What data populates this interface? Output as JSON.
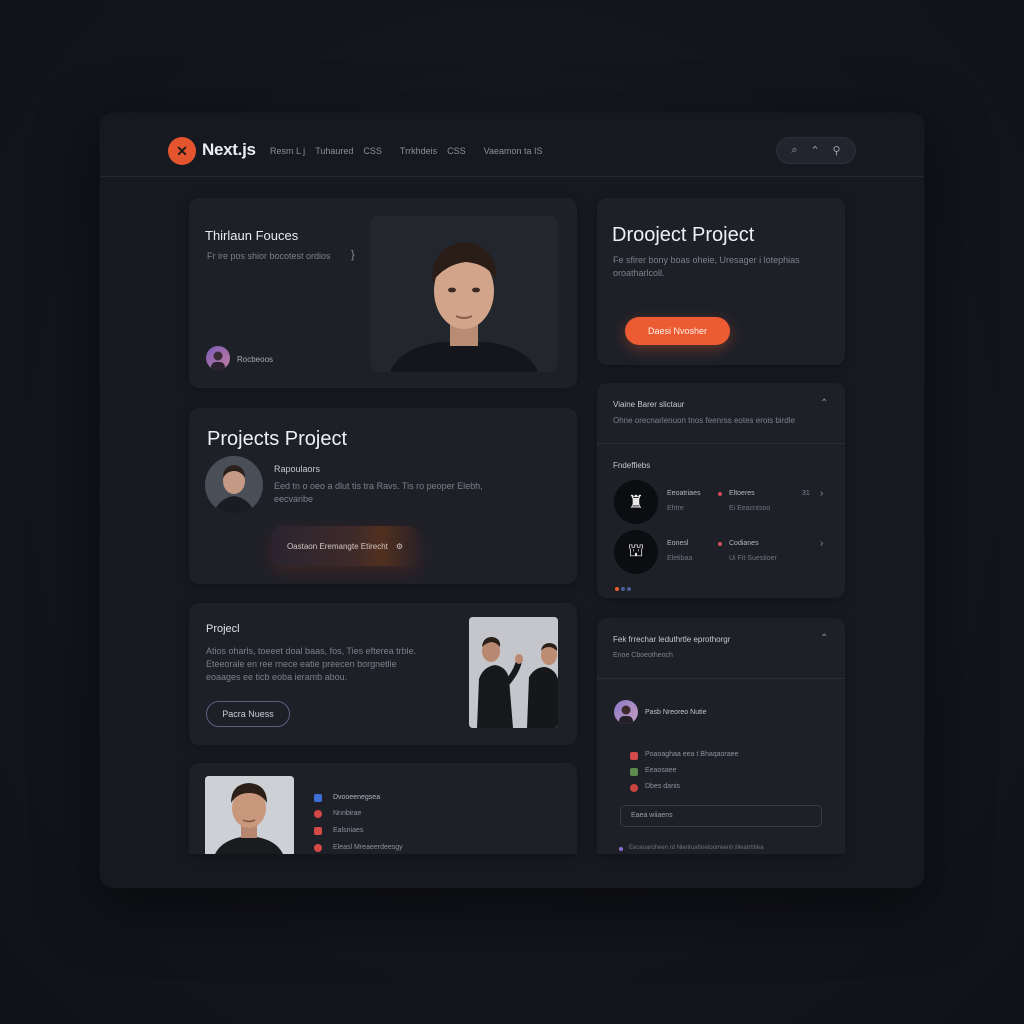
{
  "app": {
    "logo_symbol": "✕",
    "logo_text": "Next.js",
    "nav": [
      "Resm L j",
      "Tuhaured",
      "CSS",
      "Trrkhdeis",
      "CSS",
      "Vaeamon ta IS"
    ],
    "search_icons": [
      "search-icon",
      "bell-icon",
      "user-icon"
    ],
    "search_glyphs": [
      "⌕",
      "⌃",
      "⚲"
    ]
  },
  "colors": {
    "accent": "#ec5b32",
    "bg": "#171920",
    "card": "#1e2028"
  },
  "hero": {
    "title": "Thirlaun Fouces",
    "text": "Fr ire pos shior bocotest ordios",
    "arrow": "}",
    "author": "Rocbeoos"
  },
  "project_card": {
    "title": "Drooject Project",
    "text": "Fe sfirer bony boas oheie, Uresager i lotephias oroatharlcoll.",
    "button": "Daesi Nvosher"
  },
  "projects_card": {
    "title": "Projects Project",
    "name": "Rapoulaors",
    "text": "Eed tn o oeo a dlut tis tra Ravs. Tis ro peoper Elebh, eecvaribe",
    "button": "Oastaon Eremangte Etirecht",
    "button_icon": "⚙"
  },
  "settings_card": {
    "title": "Viaine Barer slictaur",
    "subtitle": "Ohne orecnarlenuon tnos feenrss eotes erois birdle",
    "section": "Fndeffiebs",
    "items": [
      {
        "icon": "cup-icon",
        "glyph": "♜",
        "a": "Eeoatriaes",
        "b": "Eltoeres",
        "num": "31",
        "c": "Ehtre",
        "d": "Ei Eeacntsoo"
      },
      {
        "icon": "basket-icon",
        "glyph": "⛫",
        "a": "Eonesl",
        "b": "Codianes",
        "num": "",
        "c": "Eletibaa",
        "d": "Ui Fit Suestioer"
      }
    ]
  },
  "proj_small": {
    "title": "Projecl",
    "text": "Atios oharls, toeeet doal baas, fos, Ties efterea trble. Eteeorale en ree rnece eatie preecen borgnetlie eoaages ee ticb eoba ieramb abou.",
    "button": "Pacra Nuess"
  },
  "feed_card": {
    "title": "Fek frrechar leduthrtle eprothorgr",
    "subtitle": "Enoe Cboeotheoch",
    "user": "Pasb Nreoreo Nutie",
    "rows": [
      "Poaoaghaa eea  t  Bhaqaoraee",
      "Eeaosaee",
      "Dbes danis"
    ],
    "input_placeholder": "Eaea wiiaens",
    "footer": "Eeceoaroheen rd Nieriruahnetoorreenh Meatrhtlea"
  },
  "bottom_card": {
    "items": [
      "Dvooeenegsea",
      "Nnnbirae",
      "Ealsniaes",
      "Eleasl Mreaeerdeesgy"
    ]
  }
}
